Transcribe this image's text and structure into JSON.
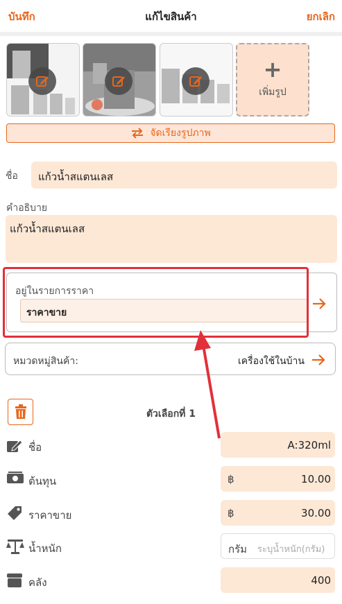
{
  "header": {
    "save_label": "บันทึก",
    "title": "แก้ไขสินค้า",
    "cancel_label": "ยกเลิก"
  },
  "photos": {
    "add_label": "เพิ่มรูป",
    "arrange_label": "จัดเรียงรูปภาพ"
  },
  "product": {
    "name_label": "ชื่อ",
    "name_value": "แก้วน้ำสแตนเลส",
    "desc_label": "คำอธิบาย",
    "desc_value": "แก้วน้ำสแตนเลส"
  },
  "price_list": {
    "label": "อยู่ในรายการราคา",
    "value": "ราคาขาย"
  },
  "category": {
    "label": "หมวดหมู่สินค้า:",
    "value": "เครื่องใช้ในบ้าน"
  },
  "variant": {
    "title": "ตัวเลือกที่ 1",
    "name_label": "ชื่อ",
    "name_value": "A:320ml",
    "cost_label": "ต้นทุน",
    "cost_prefix": "฿",
    "cost_value": "10.00",
    "price_label": "ราคาขาย",
    "price_prefix": "฿",
    "price_value": "30.00",
    "weight_label": "น้ำหนัก",
    "weight_unit": "กรัม",
    "weight_placeholder": "ระบุน้ำหนัก(กรัม)",
    "stock_label": "คลัง",
    "stock_value": "400"
  },
  "colors": {
    "accent": "#e8661c",
    "field_bg": "#fde8d6",
    "highlight": "#e2303a"
  },
  "icons": [
    "pencil-icon",
    "swap-arrows-icon",
    "plus-icon",
    "arrow-right-icon",
    "trash-icon",
    "edit-icon",
    "money-icon",
    "price-tag-icon",
    "scale-icon",
    "stock-icon"
  ]
}
